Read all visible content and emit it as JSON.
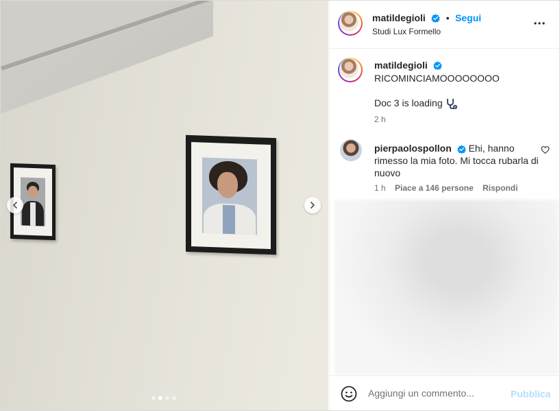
{
  "post": {
    "username": "matildegioli",
    "location": "Studi Lux Formello",
    "follow_label": "Segui",
    "separator": "•",
    "verified": true
  },
  "caption": {
    "username": "matildegioli",
    "line1": "RICOMINCIAMOOOOOOOO",
    "line2": "Doc 3 is loading",
    "emoji_icon": "stethoscope-icon",
    "time": "2 h"
  },
  "comment": {
    "username": "pierpaolospollon",
    "text": "Ehi, hanno rimesso la mia foto. Mi tocca rubarla di nuovo",
    "time": "1 h",
    "likes": "Piace a 146 persone",
    "reply_label": "Rispondi"
  },
  "carousel": {
    "slide_count": 4,
    "active_index": 1
  },
  "composer": {
    "placeholder": "Aggiungi un commento...",
    "publish_label": "Pubblica"
  },
  "colors": {
    "accent": "#0095f6",
    "verified": "#0095f6",
    "publish_disabled": "#b2dffc",
    "muted_text": "#737373"
  }
}
